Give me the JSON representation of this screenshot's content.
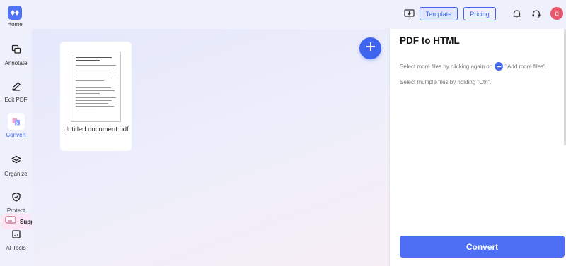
{
  "sidebar": {
    "home_label": "Home",
    "items": [
      {
        "label": "Annotate",
        "icon": "annotate-icon"
      },
      {
        "label": "Edit PDF",
        "icon": "edit-pdf-icon"
      },
      {
        "label": "Convert",
        "icon": "convert-icon",
        "active": true
      },
      {
        "label": "Organize",
        "icon": "organize-icon"
      },
      {
        "label": "Protect",
        "icon": "protect-icon"
      },
      {
        "label": "AI Tools",
        "icon": "ai-tools-icon"
      }
    ],
    "support_label": "Support"
  },
  "topbar": {
    "template_label": "Template",
    "pricing_label": "Pricing",
    "avatar_letter": "d"
  },
  "workspace": {
    "file": {
      "name": "Untitled document.pdf"
    }
  },
  "panel": {
    "title": "PDF to HTML",
    "hint1_before": "Select more files by clicking again on",
    "hint1_after": "\"Add more files\".",
    "hint2": "Select multiple files by holding \"Ctrl\".",
    "convert_label": "Convert"
  },
  "colors": {
    "accent": "#3e64f0",
    "avatar": "#e8566b"
  }
}
